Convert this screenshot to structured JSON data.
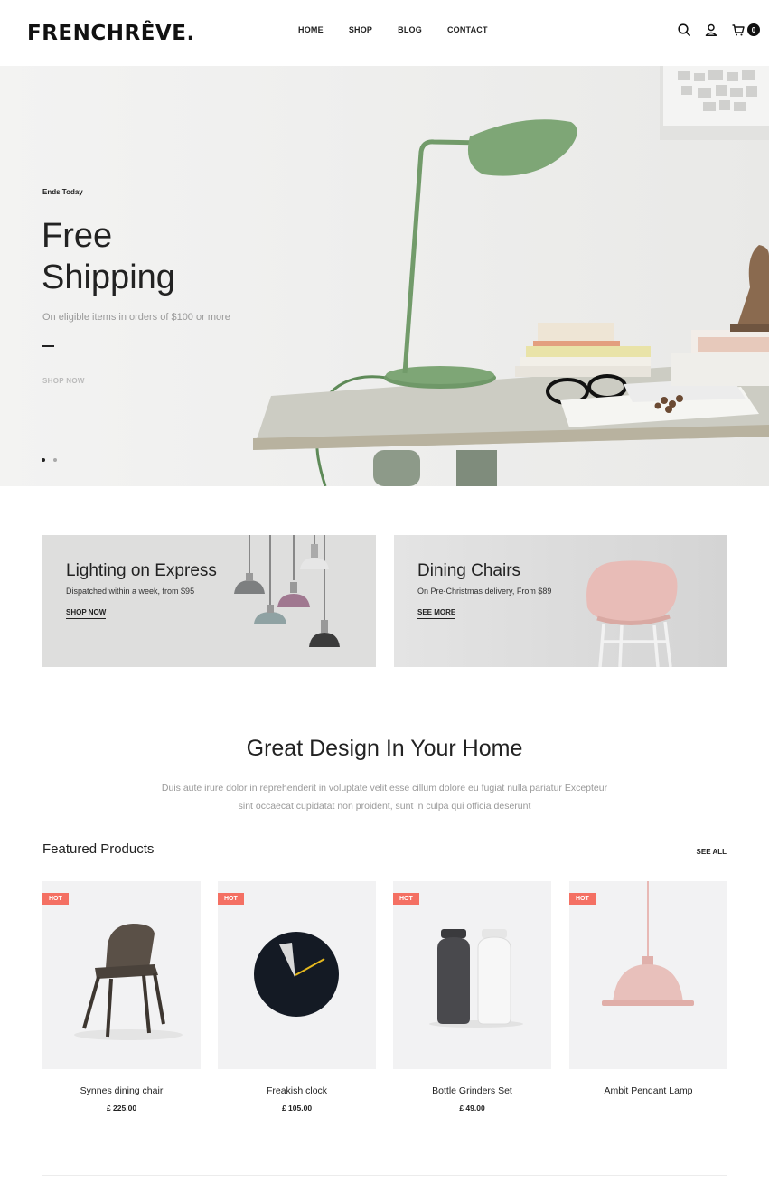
{
  "header": {
    "logo": "FRENCHRÊVE.",
    "nav": [
      "HOME",
      "SHOP",
      "BLOG",
      "CONTACT"
    ],
    "cart_count": "0",
    "icons": [
      "search-icon",
      "user-icon",
      "cart-icon"
    ]
  },
  "hero": {
    "eyebrow": "Ends Today",
    "title_line1": "Free",
    "title_line2": "Shipping",
    "subtitle": "On eligible items in orders of $100 or more",
    "cta": "SHOP NOW",
    "slides": 2,
    "active_slide": 1
  },
  "promos": [
    {
      "title": "Lighting on Express",
      "subtitle": "Dispatched within a week, from $95",
      "link": "SHOP NOW"
    },
    {
      "title": "Dining Chairs",
      "subtitle": "On Pre-Christmas delivery, From $89",
      "link": "SEE MORE"
    }
  ],
  "intro": {
    "title": "Great Design In Your Home",
    "text": "Duis aute irure dolor in reprehenderit in voluptate velit esse cillum dolore eu fugiat nulla pariatur Excepteur sint occaecat cupidatat non proident, sunt in culpa qui officia deserunt"
  },
  "featured": {
    "title": "Featured Products",
    "see_all": "SEE ALL",
    "products": [
      {
        "badge": "HOT",
        "name": "Synnes dining chair",
        "price": "£ 225.00"
      },
      {
        "badge": "HOT",
        "name": "Freakish clock",
        "price": "£ 105.00"
      },
      {
        "badge": "HOT",
        "name": "Bottle Grinders Set",
        "price": "£ 49.00"
      },
      {
        "badge": "HOT",
        "name": "Ambit Pendant Lamp",
        "price": ""
      }
    ]
  },
  "colors": {
    "accent_badge": "#f47063",
    "text_dark": "#222222",
    "text_muted": "#999999"
  }
}
